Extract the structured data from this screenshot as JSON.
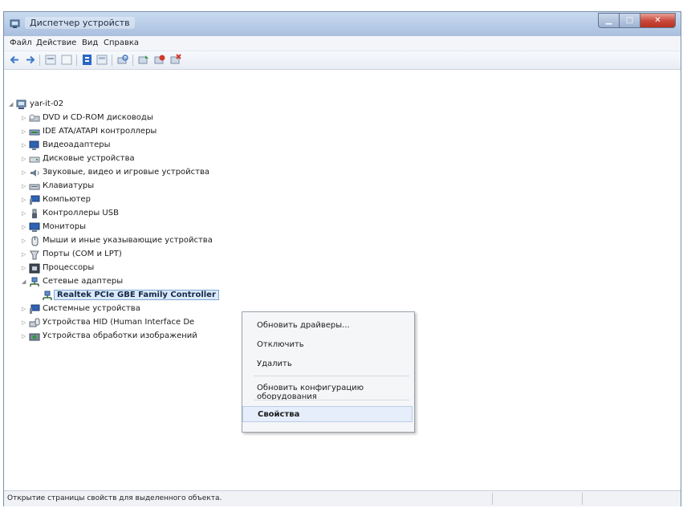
{
  "window": {
    "title": "Диспетчер устройств"
  },
  "menu": [
    "Файл",
    "Действие",
    "Вид",
    "Справка"
  ],
  "toolbar": {
    "icons": [
      "back-icon",
      "forward-icon",
      "properties-icon",
      "view-icon",
      "help-icon",
      "show-hidden-icon",
      "scan-hardware-icon",
      "update-driver-icon",
      "disable-device-icon",
      "uninstall-icon"
    ]
  },
  "tree": {
    "root": "yar-it-02",
    "categories": [
      "DVD и CD-ROM дисководы",
      "IDE ATA/ATAPI контроллеры",
      "Видеоадаптеры",
      "Дисковые устройства",
      "Звуковые, видео и игровые устройства",
      "Клавиатуры",
      "Компьютер",
      "Контроллеры USB",
      "Мониторы",
      "Мыши и иные указывающие устройства",
      "Порты (COM и LPT)",
      "Процессоры",
      "Сетевые адаптеры"
    ],
    "selected_device": "Realtek PCIe GBE Family Controller",
    "after": [
      "Системные устройства",
      "Устройства HID (Human Interface De",
      "Устройства обработки изображений"
    ]
  },
  "context_menu": {
    "items": [
      "Обновить драйверы...",
      "Отключить",
      "Удалить",
      "Обновить конфигурацию оборудования",
      "Свойства"
    ]
  },
  "status": {
    "text": "Открытие страницы свойств для выделенного объекта."
  }
}
